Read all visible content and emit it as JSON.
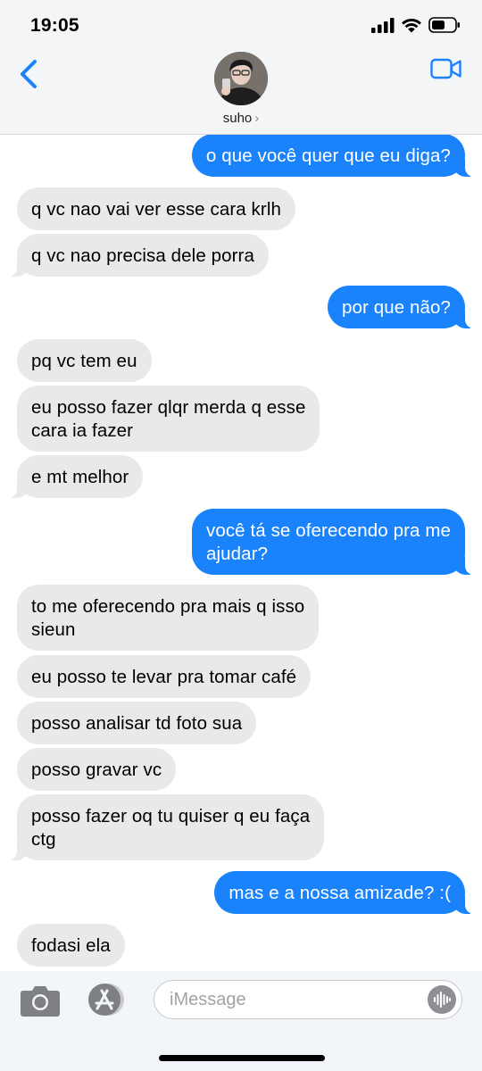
{
  "status": {
    "time": "19:05",
    "icons": [
      "cellular-signal-icon",
      "wifi-icon",
      "battery-icon"
    ]
  },
  "header": {
    "contact_name": "suho",
    "chevron": "›",
    "icons": [
      "back-chevron-icon",
      "video-camera-icon"
    ]
  },
  "messages": [
    {
      "dir": "sent",
      "text": "o que você quer que eu diga?"
    },
    {
      "dir": "recv",
      "text": "q vc nao vai ver esse cara krlh"
    },
    {
      "dir": "recv",
      "text": "q vc nao precisa dele porra"
    },
    {
      "dir": "sent",
      "text": "por que não?"
    },
    {
      "dir": "recv",
      "text": "pq vc tem eu"
    },
    {
      "dir": "recv",
      "text": "eu posso fazer qlqr merda q esse\ncara ia fazer"
    },
    {
      "dir": "recv",
      "text": "e mt melhor"
    },
    {
      "dir": "sent",
      "text": "você tá se oferecendo pra me\najudar?"
    },
    {
      "dir": "recv",
      "text": "to me oferecendo pra mais q isso\nsieun"
    },
    {
      "dir": "recv",
      "text": "eu posso te levar pra tomar café"
    },
    {
      "dir": "recv",
      "text": "posso analisar td foto sua"
    },
    {
      "dir": "recv",
      "text": "posso gravar vc"
    },
    {
      "dir": "recv",
      "text": "posso fazer oq tu quiser q eu faça\nctg"
    },
    {
      "dir": "sent",
      "text": "mas e a nossa amizade? :("
    },
    {
      "dir": "recv",
      "text": "fodasi ela"
    }
  ],
  "composer": {
    "placeholder": "iMessage",
    "icons": [
      "camera-icon",
      "app-store-icon",
      "audio-waveform-icon"
    ]
  },
  "colors": {
    "sent_bubble": "#1a82fb",
    "recv_bubble": "#e9e9eb",
    "accent": "#1a82fb"
  }
}
